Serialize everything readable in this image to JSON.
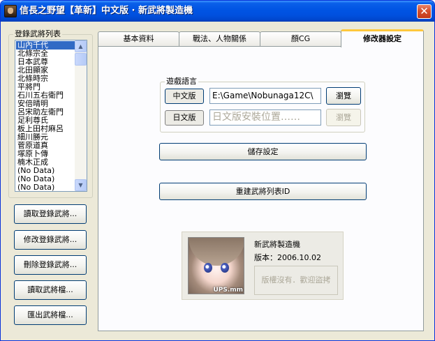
{
  "window": {
    "title": "信長之野望【革新】中文版 · 新武將製造機",
    "close_glyph": "✕"
  },
  "list_panel": {
    "legend": "登錄武將列表",
    "items": [
      "山內千代",
      "北條宗全",
      "日本武尊",
      "北田顯家",
      "北條時宗",
      "平將門",
      "石川五右衛門",
      "安倍晴明",
      "呂宋助左衛門",
      "足利尊氏",
      "板上田村麻呂",
      "細川勝元",
      "菅原道真",
      "塚原卜傳",
      "楠木正成",
      "(No Data)",
      "(No Data)",
      "(No Data)"
    ],
    "selected_index": 0
  },
  "left_buttons": {
    "load_registered": "讀取登錄武將...",
    "edit_registered": "修改登錄武將...",
    "delete_registered": "刪除登錄武將...",
    "load_file": "讀取武將檔...",
    "export_file": "匯出武將檔..."
  },
  "tabs": {
    "basic": "基本資料",
    "tactics": "戰法、人物關係",
    "face_cg": "顏CG",
    "settings": "修改器設定"
  },
  "settings": {
    "language_legend": "遊戲語言",
    "chinese_label": "中文版",
    "chinese_path": "E:\\Game\\Nobunaga12C\\",
    "browse_label": "瀏覽",
    "japanese_label": "日文版",
    "japanese_placeholder": "日文版安裝位置……",
    "browse_disabled_label": "瀏覽",
    "save_label": "儲存設定",
    "rebuild_label": "重建武將列表ID"
  },
  "about": {
    "name": "新武將製造機",
    "version": "版本：2006.10.02",
    "copyright": "版權沒有．歡迎盜拷",
    "avatar_caption": "UPS.mm"
  }
}
